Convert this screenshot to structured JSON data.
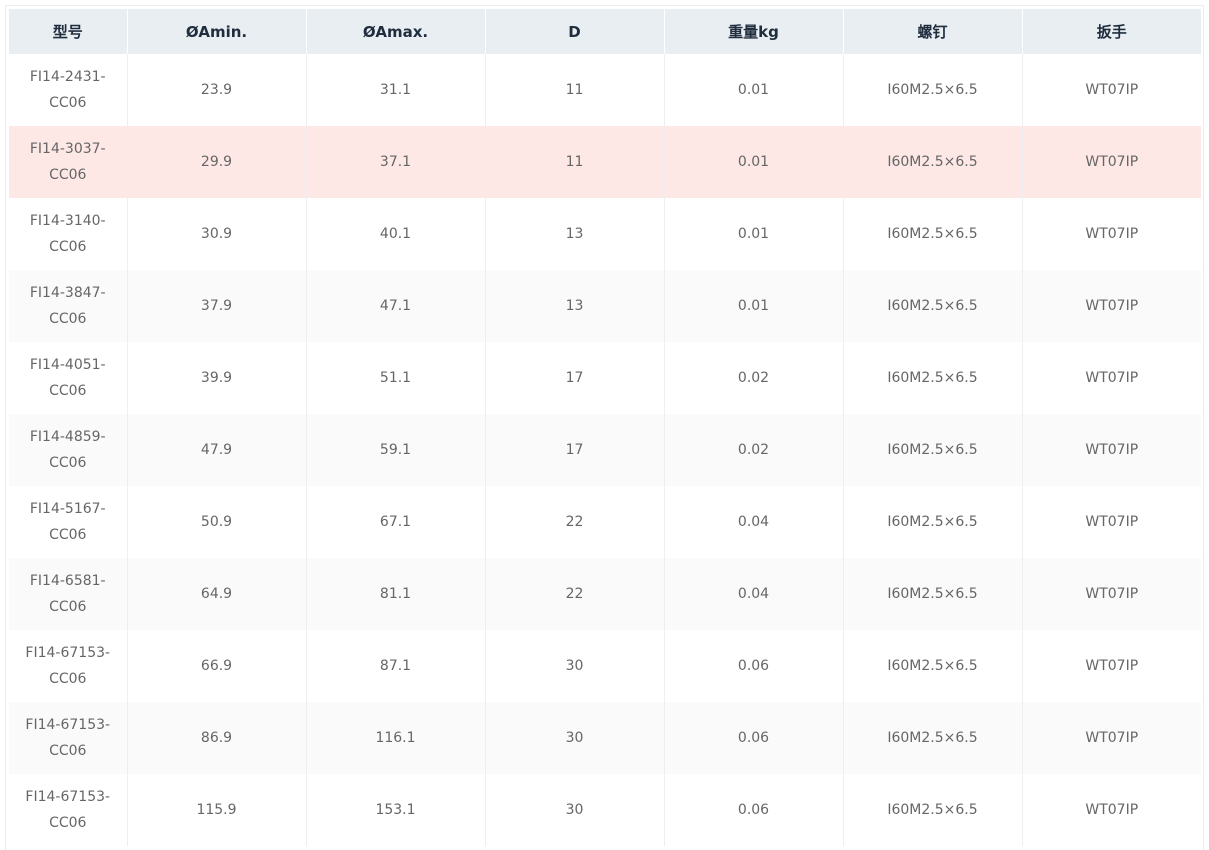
{
  "table": {
    "headers": [
      "型号",
      "ØAmin.",
      "ØAmax.",
      "D",
      "重量kg",
      "螺钉",
      "扳手"
    ],
    "rows": [
      [
        "FI14-2431-CC06",
        "23.9",
        "31.1",
        "11",
        "0.01",
        "I60M2.5×6.5",
        "WT07IP"
      ],
      [
        "FI14-3037-CC06",
        "29.9",
        "37.1",
        "11",
        "0.01",
        "I60M2.5×6.5",
        "WT07IP"
      ],
      [
        "FI14-3140-CC06",
        "30.9",
        "40.1",
        "13",
        "0.01",
        "I60M2.5×6.5",
        "WT07IP"
      ],
      [
        "FI14-3847-CC06",
        "37.9",
        "47.1",
        "13",
        "0.01",
        "I60M2.5×6.5",
        "WT07IP"
      ],
      [
        "FI14-4051-CC06",
        "39.9",
        "51.1",
        "17",
        "0.02",
        "I60M2.5×6.5",
        "WT07IP"
      ],
      [
        "FI14-4859-CC06",
        "47.9",
        "59.1",
        "17",
        "0.02",
        "I60M2.5×6.5",
        "WT07IP"
      ],
      [
        "FI14-5167-CC06",
        "50.9",
        "67.1",
        "22",
        "0.04",
        "I60M2.5×6.5",
        "WT07IP"
      ],
      [
        "FI14-6581-CC06",
        "64.9",
        "81.1",
        "22",
        "0.04",
        "I60M2.5×6.5",
        "WT07IP"
      ],
      [
        "FI14-67153-CC06",
        "66.9",
        "87.1",
        "30",
        "0.06",
        "I60M2.5×6.5",
        "WT07IP"
      ],
      [
        "FI14-67153-CC06",
        "86.9",
        "116.1",
        "30",
        "0.06",
        "I60M2.5×6.5",
        "WT07IP"
      ],
      [
        "FI14-67153-CC06",
        "115.9",
        "153.1",
        "30",
        "0.06",
        "I60M2.5×6.5",
        "WT07IP"
      ]
    ],
    "highlighted_row": 1
  },
  "colors": {
    "header_bg": "#e9eef3",
    "highlight_bg": "#fde8e6",
    "stripe_bg": "#fafafa"
  }
}
